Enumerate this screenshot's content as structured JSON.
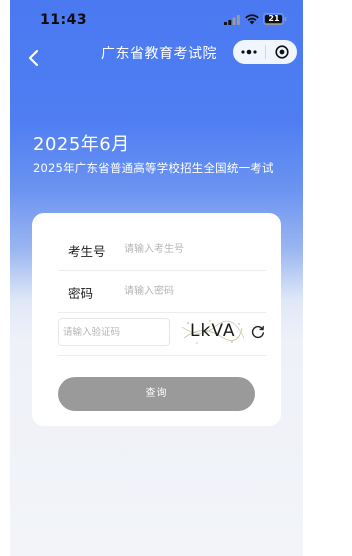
{
  "status_bar": {
    "time": "11:43",
    "battery": "21",
    "signal_icon": "signal-bars-icon",
    "wifi_icon": "wifi-icon",
    "battery_icon": "battery-icon"
  },
  "nav": {
    "title": "广东省教育考试院",
    "back_icon": "chevron-left-icon",
    "more_icon": "more-dots-icon",
    "close_icon": "target-close-icon"
  },
  "hero": {
    "date": "2025年6月",
    "exam_name": "2025年广东省普通高等学校招生全国统一考试"
  },
  "form": {
    "candidate_id": {
      "label": "考生号",
      "placeholder": "请输入考生号",
      "value": ""
    },
    "password": {
      "label": "密码",
      "placeholder": "请输入密码",
      "value": ""
    },
    "captcha": {
      "placeholder": "请输入验证码",
      "value": "",
      "image_text": "LkVA",
      "refresh_icon": "refresh-icon"
    },
    "submit_label": "查询"
  },
  "colors": {
    "primary_blue": "#4a79f2",
    "button_disabled": "#9a9a9a",
    "card_bg": "#ffffff",
    "page_bg": "#f2f4f9"
  }
}
